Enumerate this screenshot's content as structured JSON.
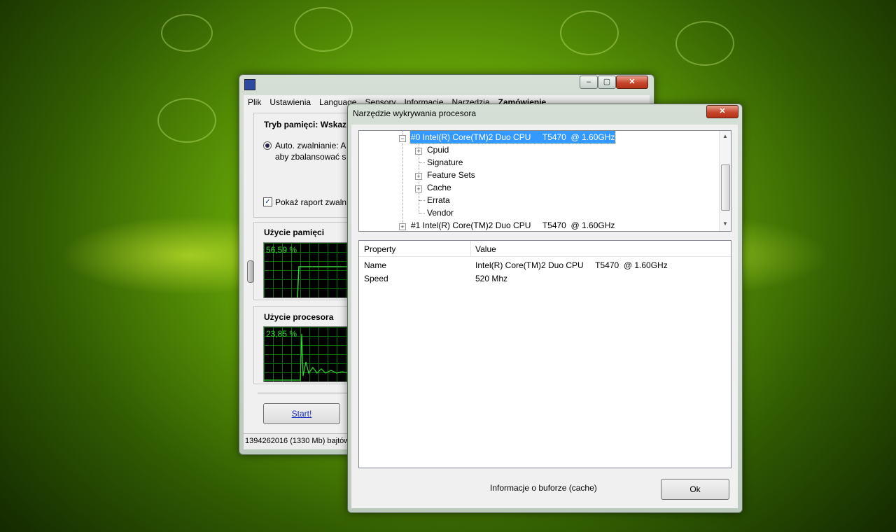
{
  "main_window": {
    "menu": [
      "Plik",
      "Ustawienia",
      "Language",
      "Sensory",
      "Informacje",
      "Narzędzia",
      "Zamówienie"
    ],
    "memory_mode_title": "Tryb pamięci: Wskaz",
    "auto_label": "Auto. zwalnianie: A",
    "auto_label2": "aby zbalansować s",
    "show_report_label": "Pokaż raport zwaln",
    "memory_usage_title": "Użycie pamięci",
    "memory_usage_pct": "56,59 %",
    "cpu_usage_title": "Użycie procesora",
    "cpu_usage_pct": "23,85 %",
    "start_button": "Start!",
    "status_text": "1394262016 (1330 Mb) bajtów"
  },
  "dialog": {
    "title": "Narzędzie wykrywania procesora",
    "close_label": "✕",
    "tree": {
      "cpu0": "#0 Intel(R) Core(TM)2 Duo CPU     T5470  @ 1.60GHz",
      "children": [
        "Cpuid",
        "Signature",
        "Feature Sets",
        "Cache",
        "Errata",
        "Vendor"
      ],
      "cpu1": "#1 Intel(R) Core(TM)2 Duo CPU     T5470  @ 1.60GHz"
    },
    "table": {
      "headers": [
        "Property",
        "Value"
      ],
      "rows": [
        [
          "Name",
          "Intel(R) Core(TM)2 Duo CPU     T5470  @ 1.60GHz"
        ],
        [
          "Speed",
          "520 Mhz"
        ]
      ]
    },
    "footer_text": "Informacje o buforze (cache)",
    "ok_button": "Ok"
  },
  "colors": {
    "selection": "#3399ff",
    "graph_line": "#35d835",
    "close_button": "#c6462c"
  }
}
